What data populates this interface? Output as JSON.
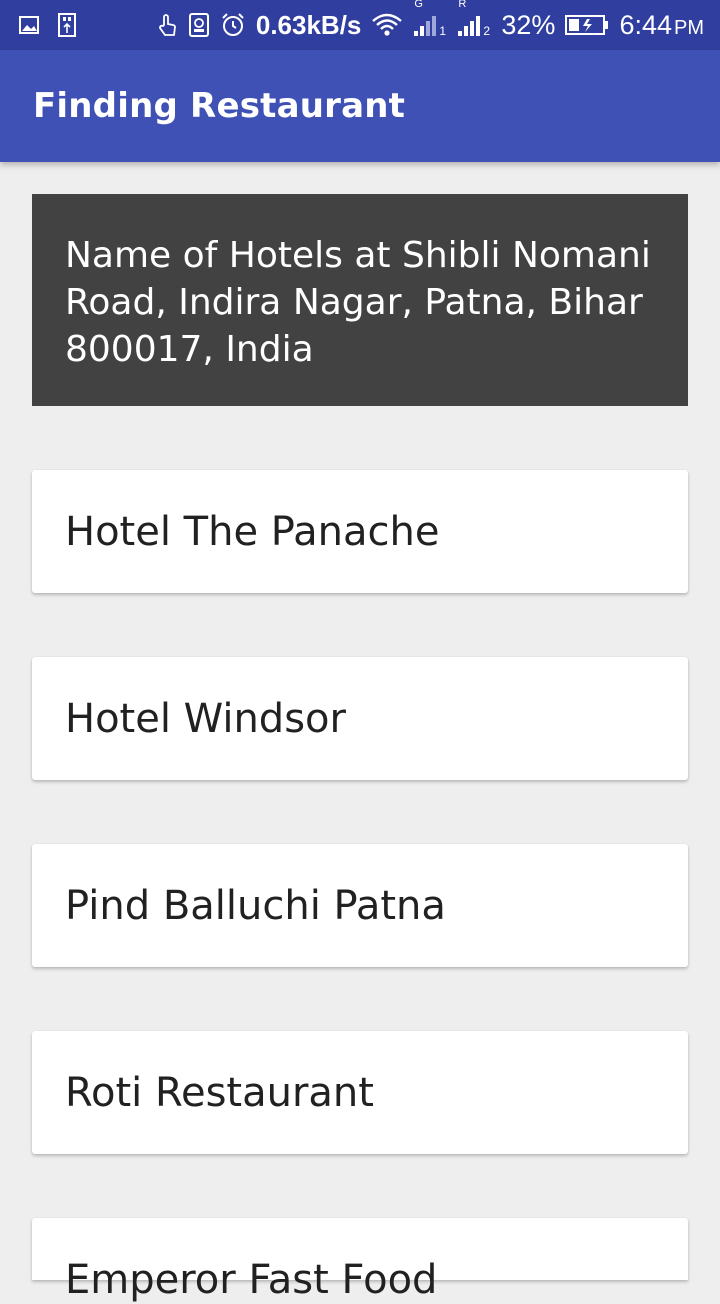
{
  "status_bar": {
    "net_speed": "0.63kB/s",
    "sim1_label": "G",
    "sim1_index": "1",
    "sim2_label": "R",
    "sim2_index": "2",
    "battery": "32%",
    "battery_level": 0.32,
    "time": "6:44",
    "ampm": "PM",
    "icons": [
      "gallery-icon",
      "usb-icon",
      "touch-icon",
      "sim-toolkit-icon",
      "alarm-icon",
      "wifi-icon",
      "signal-icon",
      "signal-icon",
      "battery-icon"
    ]
  },
  "app_bar": {
    "title": "Finding Restaurant"
  },
  "header": {
    "text": "Name of Hotels at Shibli Nomani Road, Indira Nagar, Patna, Bihar 800017, India"
  },
  "restaurants": [
    "Hotel The Panache",
    "Hotel Windsor",
    "Pind Balluchi Patna",
    "Roti Restaurant",
    "Emperor Fast Food"
  ],
  "colors": {
    "status_bar": "#303f9f",
    "app_bar": "#3f51b5",
    "header_card": "#424242",
    "background": "#eeeeee"
  }
}
